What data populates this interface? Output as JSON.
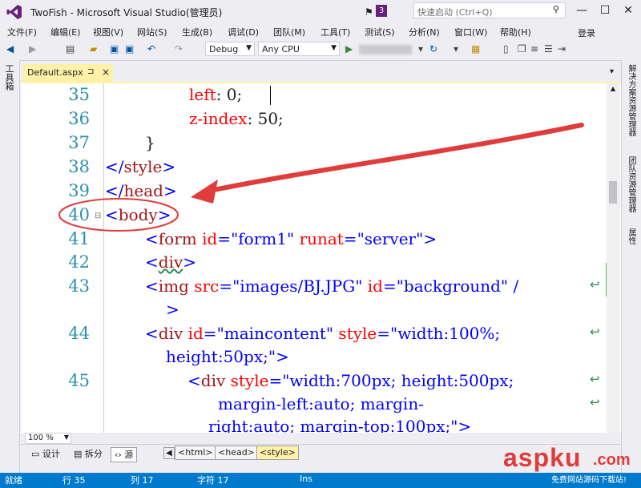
{
  "title_bar": {
    "title": "TwoFish - Microsoft Visual Studio(管理员)",
    "notification_count": "3",
    "quick_launch_placeholder": "快速启动 (Ctrl+Q)",
    "minimize": "—",
    "maximize": "☐",
    "close": "✕"
  },
  "menu": {
    "items": [
      "文件(F)",
      "编辑(E)",
      "视图(V)",
      "网站(S)",
      "生成(B)",
      "调试(D)",
      "团队(M)",
      "工具(T)",
      "测试(S)",
      "分析(N)",
      "窗口(W)",
      "帮助(H)"
    ],
    "login": "登录"
  },
  "toolbar": {
    "config": "Debug",
    "platform": "Any CPU"
  },
  "left_strip": {
    "toolbox": "工具箱"
  },
  "right_strip": {
    "solution_explorer": "解决方案资源管理器",
    "team_explorer": "团队资源管理器",
    "properties": "属性"
  },
  "tab": {
    "filename": "Default.aspx",
    "pin": "⊐",
    "close": "×"
  },
  "editor": {
    "lines": [
      {
        "num": "35"
      },
      {
        "num": "36"
      },
      {
        "num": "37"
      },
      {
        "num": "38"
      },
      {
        "num": "39"
      },
      {
        "num": "40"
      },
      {
        "num": "41"
      },
      {
        "num": "42"
      },
      {
        "num": "43"
      },
      {
        "num": "44"
      },
      {
        "num": "45"
      }
    ],
    "code": {
      "l35_prop": "left",
      "l35_val": ": 0;",
      "l36_prop": "z-index",
      "l36_val": ": 50;",
      "l37": "}",
      "l38_open": "</",
      "l38_tag": "style",
      "l38_close": ">",
      "l39_open": "</",
      "l39_tag": "head",
      "l39_close": ">",
      "l40_open": "<",
      "l40_tag": "body",
      "l40_close": ">",
      "l41_open": "<",
      "l41_tag": "form",
      "l41_attr1": " id",
      "l41_eq1": "=",
      "l41_val1": "\"form1\"",
      "l41_attr2": " runat",
      "l41_eq2": "=",
      "l41_val2": "\"server\"",
      "l41_close": ">",
      "l42_open": "<",
      "l42_tag": "div",
      "l42_close": ">",
      "l43_open": "<",
      "l43_tag": "img",
      "l43_attr1": " src",
      "l43_eq1": "=",
      "l43_val1": "\"images/BJ.JPG\"",
      "l43_attr2": " id",
      "l43_eq2": "=",
      "l43_val2": "\"background\"",
      "l43_slash": " /",
      "l43_cont": ">",
      "l44_open": "<",
      "l44_tag": "div",
      "l44_attr1": " id",
      "l44_eq1": "=",
      "l44_val1": "\"maincontent\"",
      "l44_attr2": " style",
      "l44_eq2": "=",
      "l44_val2": "\"width:100%;",
      "l44_cont": "height:50px;\">",
      "l45_open": "<",
      "l45_tag": "div",
      "l45_attr1": " style",
      "l45_eq1": "=",
      "l45_val1": "\"width:700px; height:500px;",
      "l45_cont1": "margin-left:auto; margin-",
      "l45_cont2": "right:auto; margin-top:100px;\">"
    }
  },
  "bottom": {
    "zoom": "100 %",
    "design": "设计",
    "split": "拆分",
    "source": "源",
    "crumbs": [
      "<html>",
      "<head>",
      "<style>"
    ]
  },
  "status": {
    "ready": "就绪",
    "row": "行 35",
    "col": "列 17",
    "char": "字符 17",
    "mode": "Ins"
  },
  "watermark": {
    "brand": "aspku",
    "domain": ".com",
    "slogan": "免费网站源码下载站!"
  },
  "colors": {
    "status_bar": "#007acc",
    "tab_active": "#fff1a8",
    "annotation_red": "#e03c3c",
    "vs_purple": "#68217a"
  }
}
